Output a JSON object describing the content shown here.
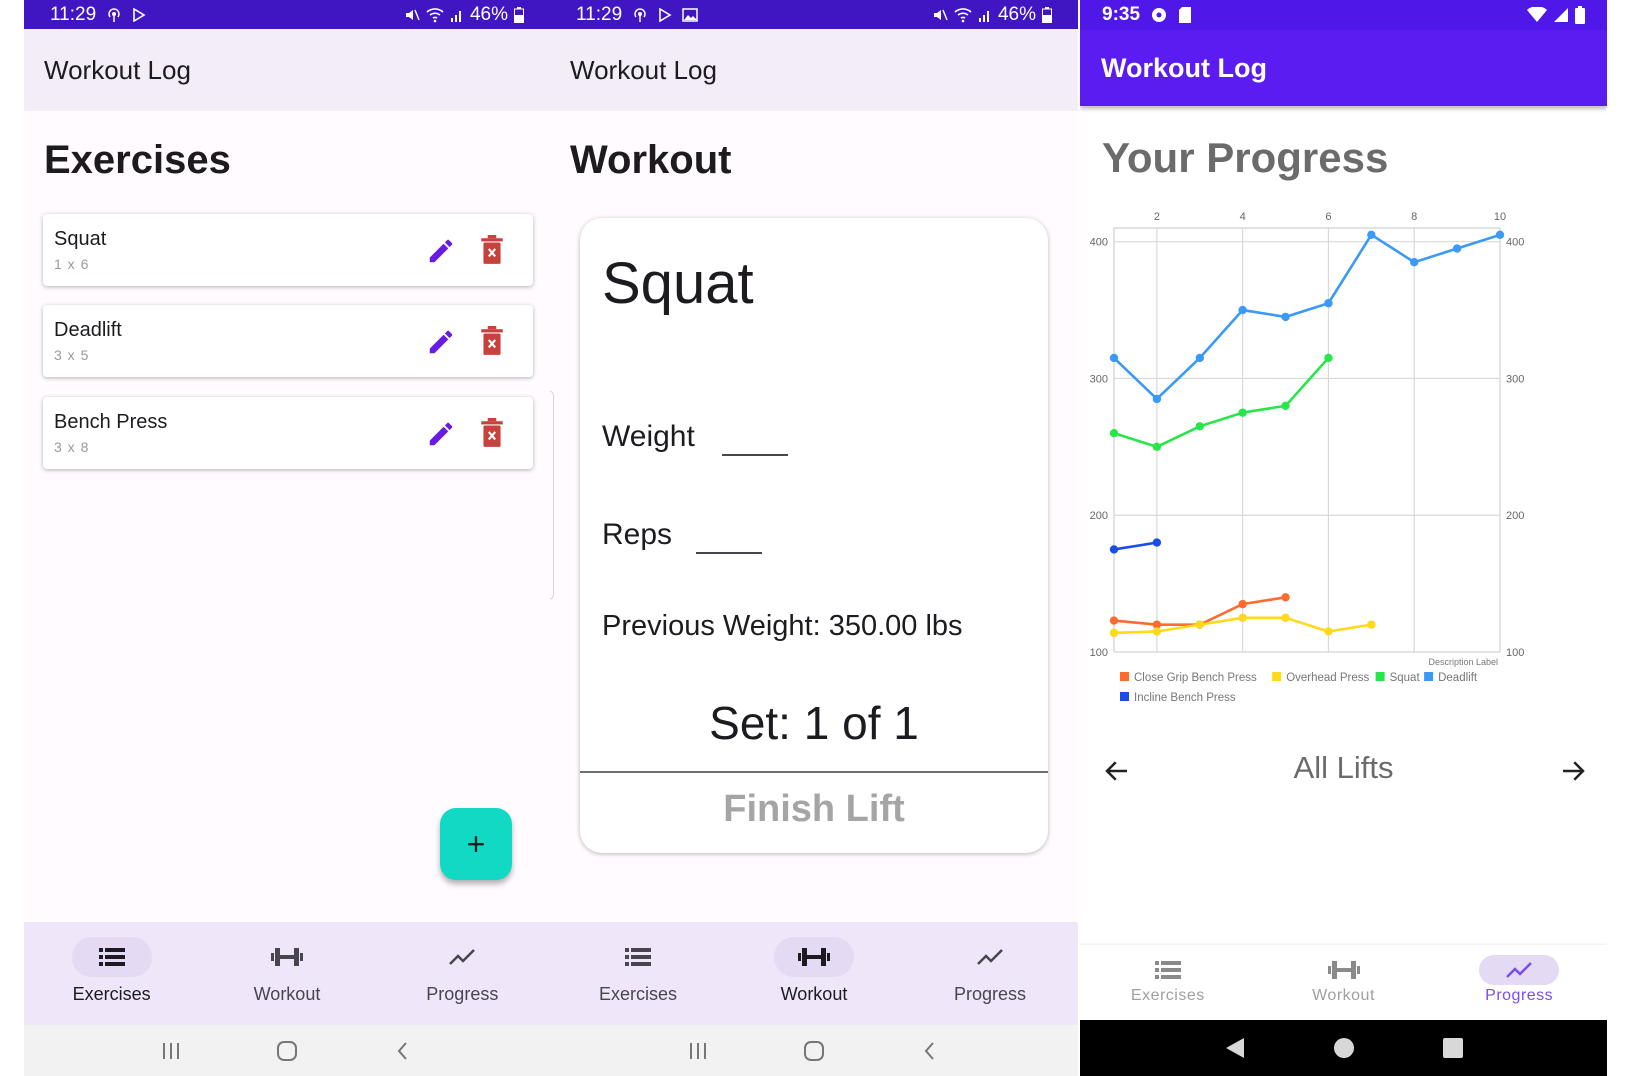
{
  "screens": {
    "exercises": {
      "status": {
        "time": "11:29",
        "battery": "46%"
      },
      "app_title": "Workout Log",
      "title": "Exercises",
      "items": [
        {
          "name": "Squat",
          "sets": "1 x 6"
        },
        {
          "name": "Deadlift",
          "sets": "3 x 5"
        },
        {
          "name": "Bench Press",
          "sets": "3 x 8"
        }
      ],
      "fab_label": "+"
    },
    "workout": {
      "status": {
        "time": "11:29",
        "battery": "46%"
      },
      "app_title": "Workout Log",
      "title": "Workout",
      "exercise_name": "Squat",
      "weight_label": "Weight",
      "reps_label": "Reps",
      "previous_weight": "Previous Weight: 350.00 lbs",
      "set_progress": "Set: 1 of 1",
      "finish_label": "Finish Lift"
    },
    "progress": {
      "status": {
        "time": "9:35"
      },
      "app_title": "Workout Log",
      "title": "Your Progress",
      "filter_label": "All Lifts"
    }
  },
  "nav": {
    "items": [
      {
        "label": "Exercises"
      },
      {
        "label": "Workout"
      },
      {
        "label": "Progress"
      }
    ]
  },
  "colors": {
    "status_bar": "#3f16c2",
    "app_bar_light": "#f3edf7",
    "app_bar_dark": "#5a1cf0",
    "edit_icon": "#6a1be3",
    "delete_icon": "#c7413d",
    "fab": "#12d9c3",
    "nav_bg": "#f0e6f9",
    "nav_active_pill": "#e4daf3"
  },
  "icons": {
    "edit": "pencil-icon",
    "delete": "trash-icon",
    "nav_exercises": "list-icon",
    "nav_workout": "dumbbell-icon",
    "nav_progress": "trending-line-icon",
    "prev": "arrow-left-icon",
    "next": "arrow-right-icon"
  },
  "chart_data": {
    "type": "line",
    "title": "",
    "xlabel": "",
    "ylabel": "",
    "description_label": "Description Label",
    "xlim": [
      1,
      10
    ],
    "ylim": [
      100,
      410
    ],
    "x_ticks": [
      2,
      4,
      6,
      8,
      10
    ],
    "y_ticks": [
      100,
      200,
      300,
      400
    ],
    "grid": true,
    "legend_position": "bottom-left",
    "series": [
      {
        "name": "Close Grip Bench Press",
        "color": "#ff6a2e",
        "x": [
          1,
          2,
          3,
          4,
          5
        ],
        "y": [
          123,
          120,
          120,
          135,
          140
        ]
      },
      {
        "name": "Overhead Press",
        "color": "#ffd91a",
        "x": [
          1,
          2,
          3,
          4,
          5,
          6,
          7
        ],
        "y": [
          114,
          115,
          120,
          125,
          125,
          115,
          120
        ]
      },
      {
        "name": "Squat",
        "color": "#28e64a",
        "x": [
          1,
          2,
          3,
          4,
          5,
          6
        ],
        "y": [
          260,
          250,
          265,
          275,
          280,
          315
        ]
      },
      {
        "name": "Deadlift",
        "color": "#3a9af5",
        "x": [
          1,
          2,
          3,
          4,
          5,
          6,
          7,
          8,
          9,
          10
        ],
        "y": [
          315,
          285,
          315,
          350,
          345,
          355,
          405,
          385,
          395,
          405
        ]
      },
      {
        "name": "Incline Bench Press",
        "color": "#1a4de6",
        "x": [
          1,
          2
        ],
        "y": [
          175,
          180
        ]
      }
    ]
  }
}
